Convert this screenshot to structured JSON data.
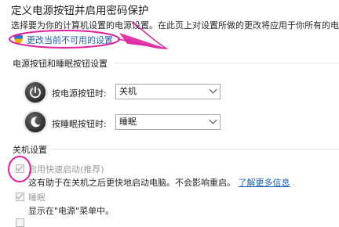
{
  "header": {
    "title": "定义电源按钮并启用密码保护",
    "description": "选择要为你的计算机设置的电源设置。在此页上对设置所做的更改将应用于你所有的电源",
    "uac_link": "更改当前不可用的设置"
  },
  "buttons_section": {
    "title": "电源按钮和睡眠按钮设置",
    "power_button_label": "按电源按钮时:",
    "power_button_value": "关机",
    "sleep_button_label": "按睡眠按钮时:",
    "sleep_button_value": "睡眠"
  },
  "shutdown_section": {
    "title": "关机设置",
    "fast_startup": {
      "label": "启用快速启动(推荐)",
      "checked": true,
      "description": "这有助于在关机之后更快地启动电脑。不会影响重启。",
      "more_info": "了解更多信息"
    },
    "sleep": {
      "label": "睡眠",
      "checked": true,
      "description": "显示在\"电源\"菜单中。"
    }
  },
  "annotation_color": "#e0209f"
}
